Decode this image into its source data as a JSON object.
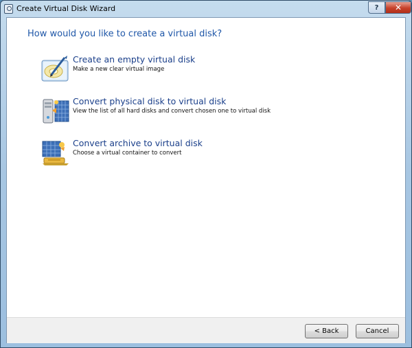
{
  "window": {
    "title": "Create Virtual Disk Wizard",
    "help_label": "?",
    "close_label": "✕"
  },
  "heading": "How would you like to create a virtual disk?",
  "options": [
    {
      "title": "Create an empty virtual disk",
      "description": "Make a new clear virtual image",
      "icon": "empty-disk-icon"
    },
    {
      "title": "Convert physical disk to virtual disk",
      "description": "View the list of all hard disks and convert chosen one to virtual disk",
      "icon": "physical-disk-icon"
    },
    {
      "title": "Convert archive to virtual disk",
      "description": "Choose a virtual container to convert",
      "icon": "archive-convert-icon"
    }
  ],
  "buttons": {
    "back": "< Back",
    "cancel": "Cancel"
  },
  "colors": {
    "heading": "#1f57a8",
    "option_title": "#1a3f8a",
    "close_button": "#c7412a"
  }
}
